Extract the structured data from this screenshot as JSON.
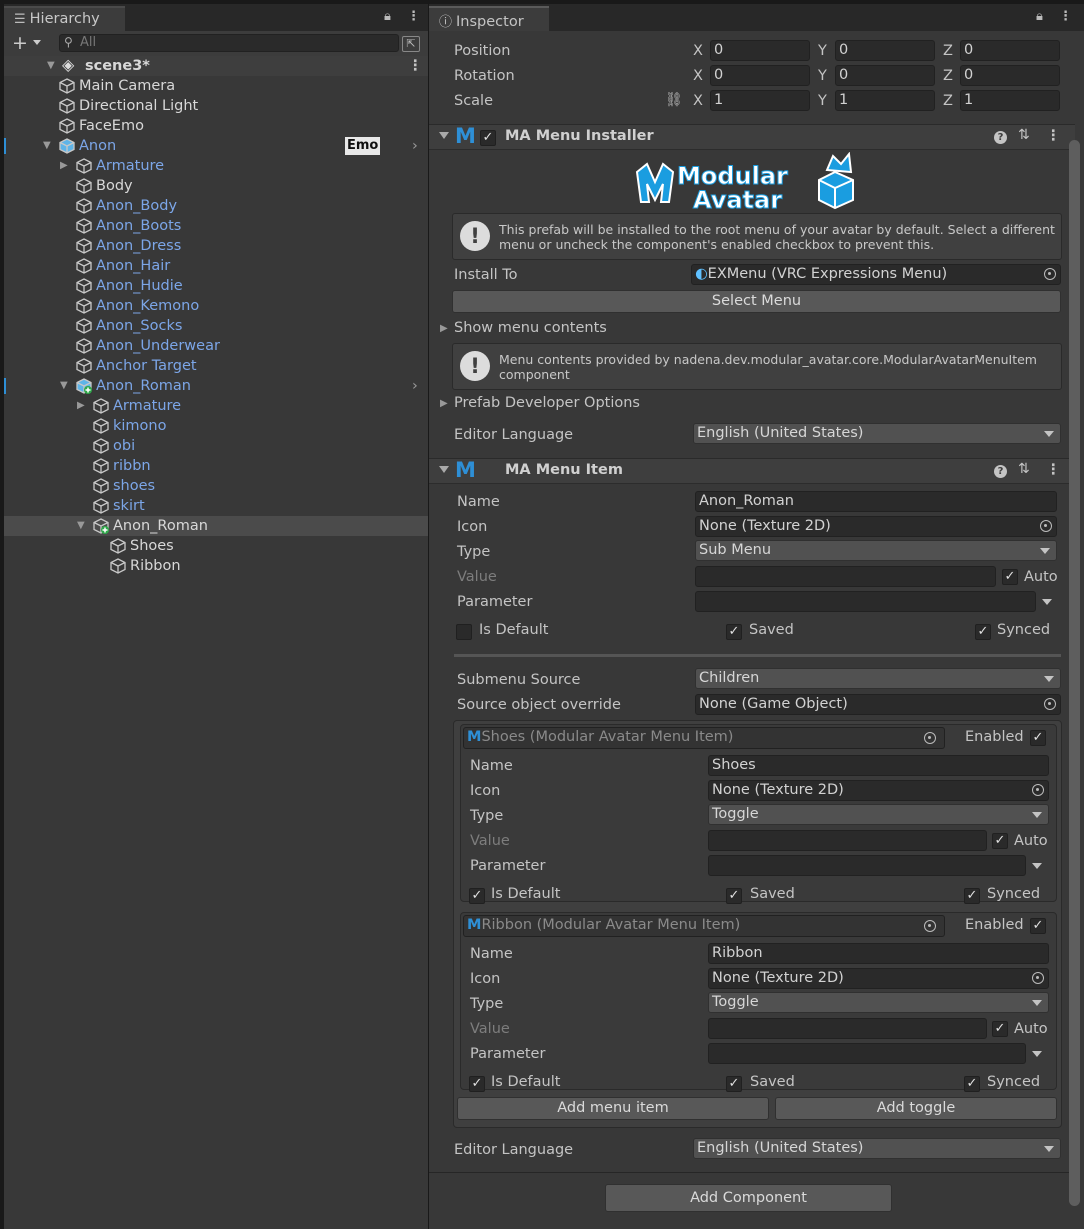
{
  "hierarchy": {
    "tab_label": "Hierarchy",
    "search_placeholder": "All",
    "scene": "scene3*",
    "items": [
      {
        "label": "Main Camera"
      },
      {
        "label": "Directional Light"
      },
      {
        "label": "FaceEmo"
      },
      {
        "label": "Anon"
      },
      {
        "label": "Armature"
      },
      {
        "label": "Body"
      },
      {
        "label": "Anon_Body"
      },
      {
        "label": "Anon_Boots"
      },
      {
        "label": "Anon_Dress"
      },
      {
        "label": "Anon_Hair"
      },
      {
        "label": "Anon_Hudie"
      },
      {
        "label": "Anon_Kemono"
      },
      {
        "label": "Anon_Socks"
      },
      {
        "label": "Anon_Underwear"
      },
      {
        "label": "Anchor Target"
      },
      {
        "label": "Anon_Roman"
      },
      {
        "label": "Armature"
      },
      {
        "label": "kimono"
      },
      {
        "label": "obi"
      },
      {
        "label": "ribbn"
      },
      {
        "label": "shoes"
      },
      {
        "label": "skirt"
      },
      {
        "label": "Anon_Roman"
      },
      {
        "label": "Shoes"
      },
      {
        "label": "Ribbon"
      }
    ],
    "badge": "Emo"
  },
  "inspector": {
    "tab_label": "Inspector",
    "transform": {
      "position_label": "Position",
      "rotation_label": "Rotation",
      "scale_label": "Scale",
      "x": "X",
      "y": "Y",
      "z": "Z",
      "position": [
        "0",
        "0",
        "0"
      ],
      "rotation": [
        "0",
        "0",
        "0"
      ],
      "scale": [
        "1",
        "1",
        "1"
      ]
    },
    "installer": {
      "title": "MA Menu Installer",
      "logo_line1": "Modular",
      "logo_line2": "Avatar",
      "help": "This prefab will be installed to the root menu of your avatar by default. Select a different menu or uncheck the component's enabled checkbox to prevent this.",
      "install_to_label": "Install To",
      "install_to_value": "EXMenu (VRC Expressions Menu)",
      "select_menu": "Select Menu",
      "show_contents": "Show menu contents",
      "contents_help": "Menu contents provided by nadena.dev.modular_avatar.core.ModularAvatarMenuItem component",
      "prefab_dev": "Prefab Developer Options",
      "editor_language_label": "Editor Language",
      "editor_language": "English (United States)"
    },
    "menu_item": {
      "title": "MA Menu Item",
      "name_label": "Name",
      "name": "Anon_Roman",
      "icon_label": "Icon",
      "icon": "None (Texture 2D)",
      "type_label": "Type",
      "type": "Sub Menu",
      "value_label": "Value",
      "auto": "Auto",
      "parameter_label": "Parameter",
      "is_default": "Is Default",
      "saved": "Saved",
      "synced": "Synced",
      "submenu_source_label": "Submenu Source",
      "submenu_source": "Children",
      "source_override_label": "Source object override",
      "source_override": "None (Game Object)",
      "children": [
        {
          "header": "Shoes (Modular Avatar Menu Item)",
          "enabled": "Enabled",
          "name": "Shoes",
          "icon": "None (Texture 2D)",
          "type": "Toggle"
        },
        {
          "header": "Ribbon (Modular Avatar Menu Item)",
          "enabled": "Enabled",
          "name": "Ribbon",
          "icon": "None (Texture 2D)",
          "type": "Toggle"
        }
      ],
      "add_menu_item": "Add menu item",
      "add_toggle": "Add toggle",
      "editor_language_label": "Editor Language",
      "editor_language": "English (United States)"
    },
    "add_component": "Add Component"
  },
  "colors": {
    "accent_blue": "#7ca6e8",
    "background": "#383838"
  }
}
